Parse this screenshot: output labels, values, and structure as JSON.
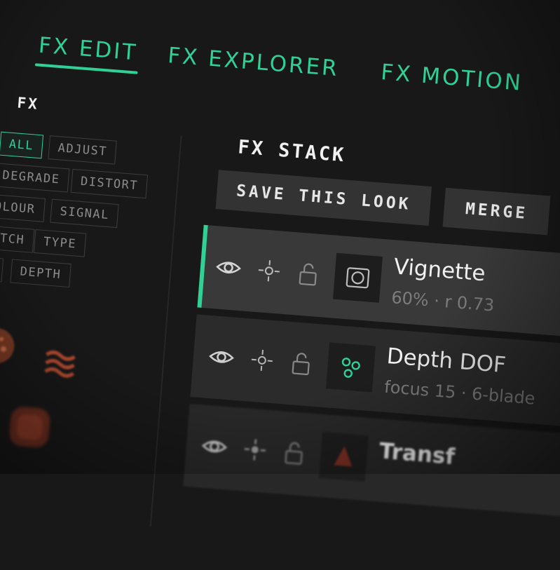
{
  "tabs": [
    {
      "label": "FX EDIT",
      "active": true
    },
    {
      "label": "FX EXPLORER",
      "active": false
    },
    {
      "label": "FX MOTION",
      "active": false
    }
  ],
  "library": {
    "title": "FX",
    "filters": [
      "ALL",
      "ADJUST",
      "DEGRADE",
      "DISTORT",
      "OLOUR",
      "SIGNAL",
      "ITCH",
      "TYPE",
      "T",
      "DEPTH"
    ],
    "active_filter": "ALL"
  },
  "stack": {
    "title": "FX STACK",
    "save_label": "SAVE THIS LOOK",
    "merge_label": "MERGE",
    "items": [
      {
        "name": "Vignette",
        "meta": "60% · r 0.73",
        "selected": true
      },
      {
        "name": "Depth DOF",
        "meta": "focus 15 · 6-blade",
        "selected": false
      },
      {
        "name": "Transf",
        "meta": "",
        "selected": false
      }
    ]
  },
  "colors": {
    "accent": "#2fd196",
    "background": "#181818",
    "panel": "#303030"
  }
}
